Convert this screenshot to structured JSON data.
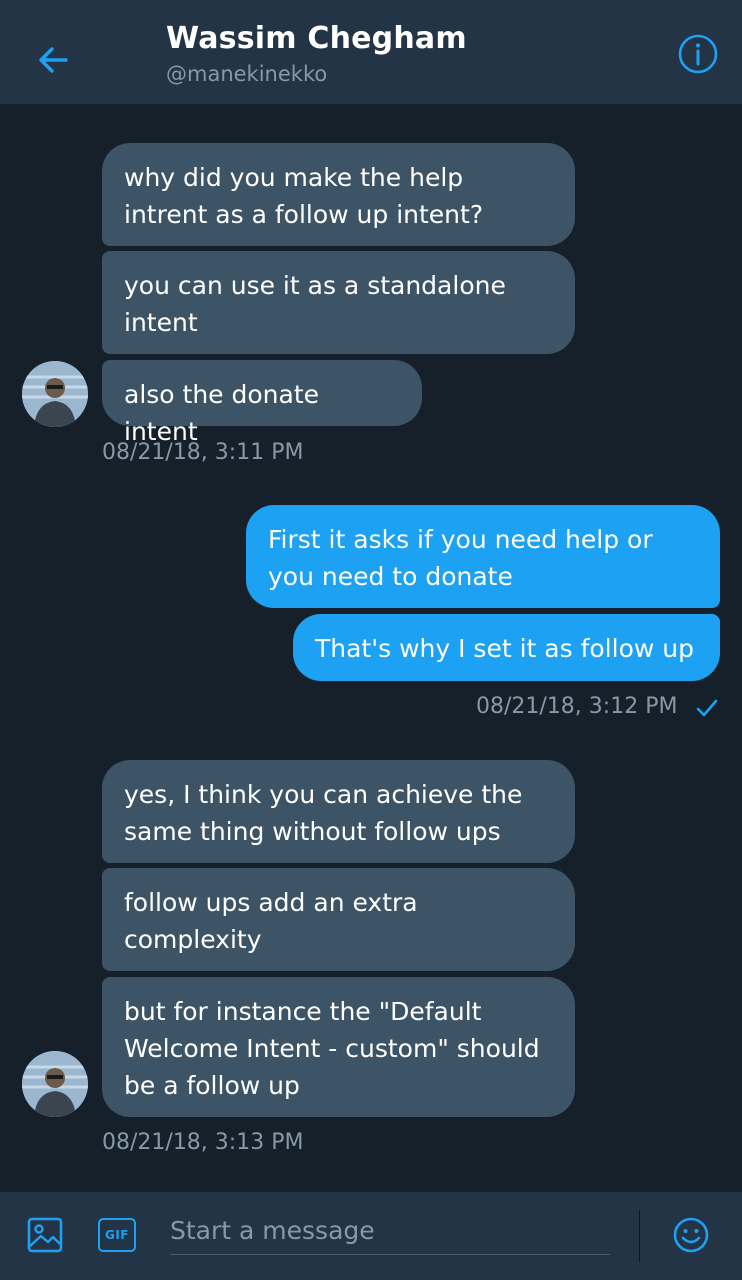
{
  "header": {
    "name": "Wassim Chegham",
    "handle": "@manekinekko",
    "back_icon": "arrow-left-icon",
    "info_icon": "info-circle-icon"
  },
  "conversation": {
    "group1": {
      "messages": [
        "why did you make the help intrent as a follow up intent?",
        "you can use it as a standalone intent",
        "also the donate intent"
      ],
      "timestamp": "08/21/18, 3:11 PM"
    },
    "group2": {
      "messages": [
        "First it asks if you need help or you need to donate",
        "That's why I set it as follow up"
      ],
      "timestamp": "08/21/18, 3:12 PM",
      "status_icon": "check-icon"
    },
    "group3": {
      "messages": [
        "yes, I think you can achieve the same thing without follow ups",
        "follow ups add an extra complexity",
        "but for instance the \"Default Welcome Intent - custom\" should be a follow up"
      ],
      "timestamp": "08/21/18, 3:13 PM"
    }
  },
  "composer": {
    "placeholder": "Start a message",
    "gif_label": "GIF",
    "image_icon": "image-icon",
    "emoji_icon": "emoji-icon"
  },
  "colors": {
    "background": "#15202b",
    "header": "#243447",
    "incoming_bubble": "#3d5466",
    "outgoing_bubble": "#1da1f2",
    "accent": "#1da1f2",
    "muted_text": "#8899a6"
  }
}
